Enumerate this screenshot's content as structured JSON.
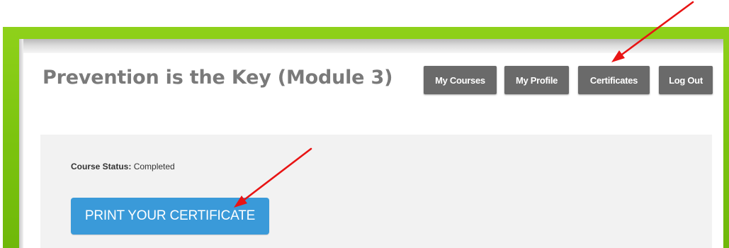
{
  "header": {
    "title": "Prevention is the Key (Module 3)"
  },
  "nav": {
    "items": [
      {
        "label": "My Courses"
      },
      {
        "label": "My Profile"
      },
      {
        "label": "Certificates"
      },
      {
        "label": "Log Out"
      }
    ]
  },
  "course": {
    "status_label": "Course Status:",
    "status_value": "Completed",
    "print_button_label": "PRINT YOUR CERTIFICATE"
  },
  "colors": {
    "frame_green": "#7cc40f",
    "nav_button_bg": "#6a6a6a",
    "print_button_bg": "#3a9ad9",
    "annotation_arrow": "#e81414",
    "title_text": "#7a7a7a"
  },
  "annotations": [
    {
      "type": "arrow",
      "points_to": "Certificates"
    },
    {
      "type": "arrow",
      "points_to": "PRINT YOUR CERTIFICATE"
    }
  ]
}
